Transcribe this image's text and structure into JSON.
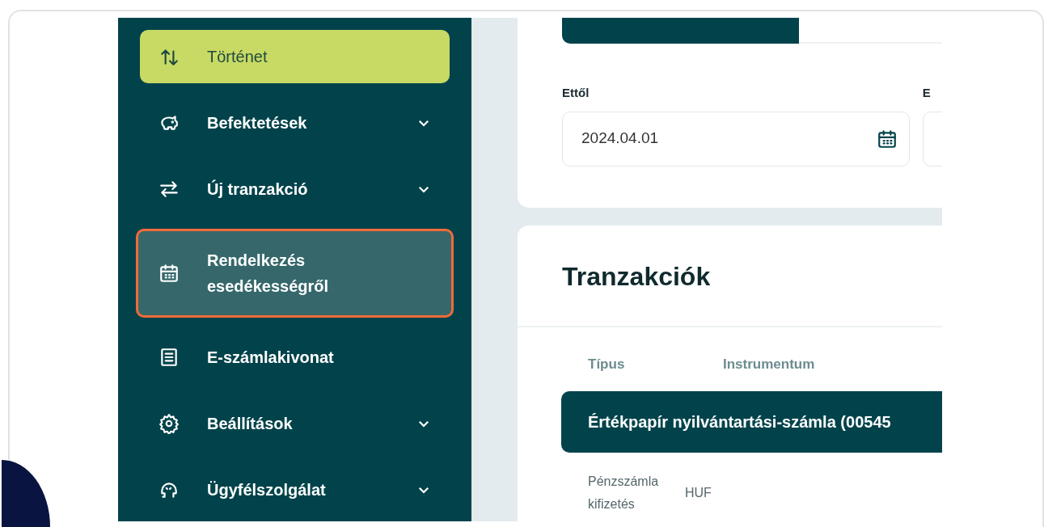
{
  "sidebar": {
    "items": [
      {
        "label": "Történet",
        "kind": "history",
        "selected": true,
        "highlighted": false,
        "expandable": false
      },
      {
        "label": "Befektetések",
        "kind": "piggy",
        "selected": false,
        "highlighted": false,
        "expandable": true
      },
      {
        "label": "Új tranzakció",
        "kind": "transfer",
        "selected": false,
        "highlighted": false,
        "expandable": true
      },
      {
        "label": "Rendelkezés esedékességről",
        "kind": "calendar",
        "selected": false,
        "highlighted": true,
        "expandable": false
      },
      {
        "label": "E-számlakivonat",
        "kind": "document",
        "selected": false,
        "highlighted": false,
        "expandable": false
      },
      {
        "label": "Beállítások",
        "kind": "gear",
        "selected": false,
        "highlighted": false,
        "expandable": true
      },
      {
        "label": "Ügyfélszolgálat",
        "kind": "headset",
        "selected": false,
        "highlighted": false,
        "expandable": true
      }
    ]
  },
  "filter": {
    "period_tabs": [
      {
        "selected": true
      },
      {
        "selected": false
      }
    ],
    "date_fields": [
      {
        "label": "Ettől",
        "value": "2024.04.01"
      },
      {
        "label": "E"
      }
    ]
  },
  "transactions": {
    "title": "Tranzakciók",
    "columns": [
      "Típus",
      "Instrumentum"
    ],
    "group": "Értékpapír nyilvántartási-számla (00545",
    "rows": [
      {
        "cells": [
          "Pénzszámla kifizetés",
          "HUF"
        ]
      }
    ]
  }
}
